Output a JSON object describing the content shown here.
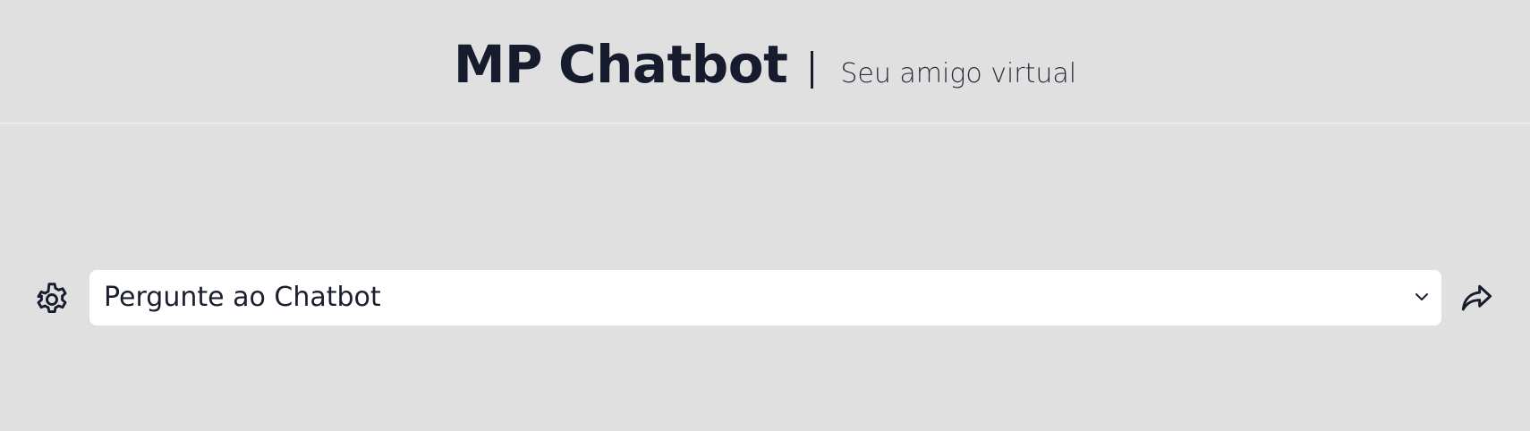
{
  "header": {
    "title_bold": "MP",
    "title_regular": "Chatbot",
    "separator": "|",
    "subtitle": "Seu amigo virtual"
  },
  "query": {
    "selected_value": "Pergunte ao Chatbot"
  },
  "icons": {
    "settings": "gear-icon",
    "dropdown": "chevron-down-icon",
    "share": "share-arrow-icon"
  },
  "colors": {
    "background": "#e0e0e0",
    "text": "#161c2d",
    "input_background": "#ffffff"
  }
}
